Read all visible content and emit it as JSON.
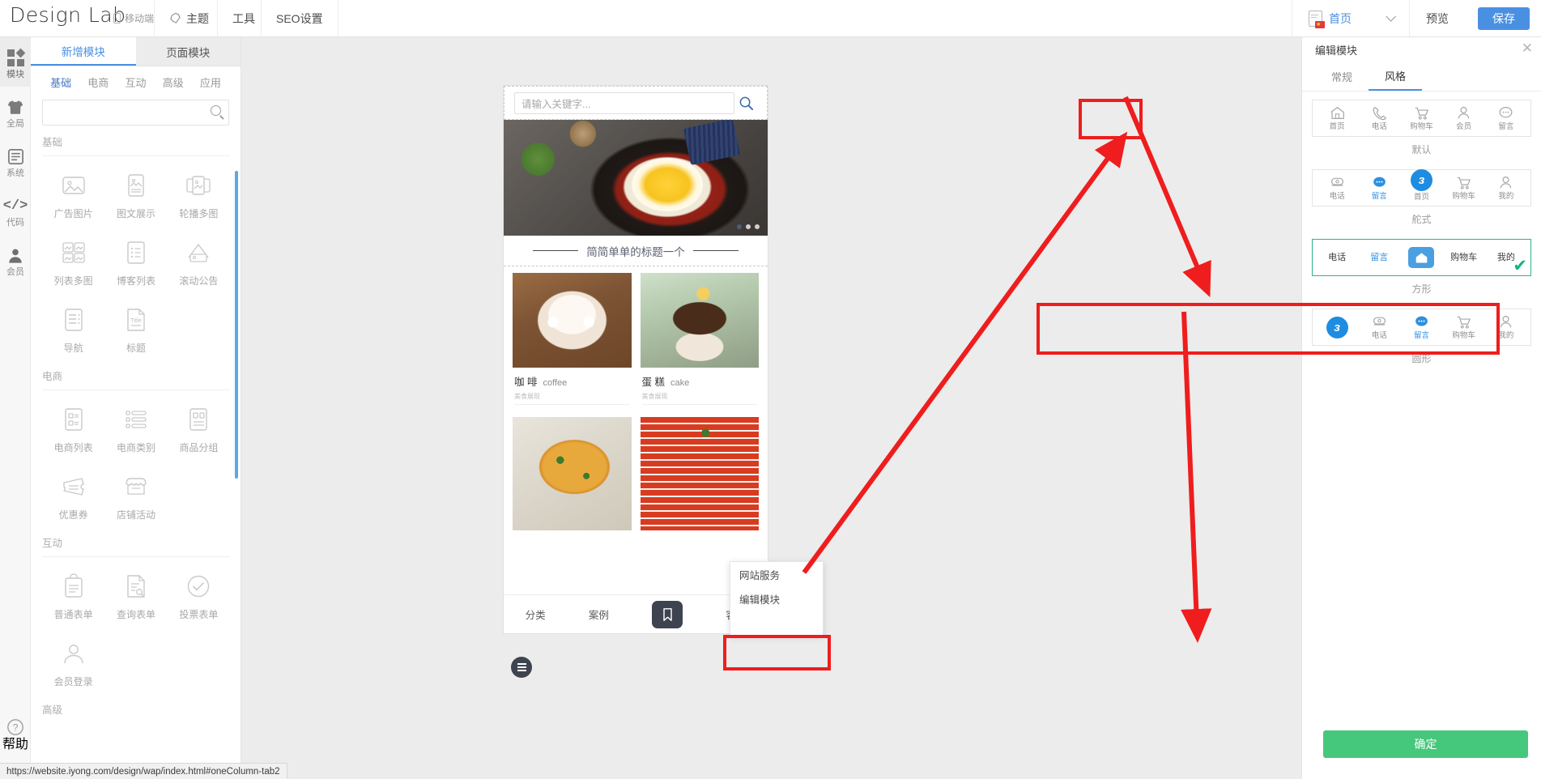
{
  "header": {
    "brand": "Design Lab",
    "device_label": "移动端",
    "menu": [
      {
        "label": "主题",
        "icon": "palette-icon"
      },
      {
        "label": "工具",
        "icon": "tools-icon"
      },
      {
        "label": "SEO设置",
        "icon": "seo-icon"
      }
    ],
    "page_selector": {
      "label": "首页",
      "icon": "page-doc-icon"
    },
    "preview_label": "预览",
    "save_label": "保存",
    "accent_blue": "#4a90e2"
  },
  "rail": {
    "items": [
      {
        "label": "模块",
        "icon": "grid-icon",
        "active": true
      },
      {
        "label": "全局",
        "icon": "shirt-icon",
        "active": false
      },
      {
        "label": "系统",
        "icon": "document-icon",
        "active": false
      },
      {
        "label": "代码",
        "icon": "code-icon",
        "active": false
      },
      {
        "label": "会员",
        "icon": "user-icon",
        "active": false
      }
    ],
    "help": {
      "label": "帮助",
      "icon": "question-circle-icon"
    }
  },
  "panel": {
    "tabs": [
      {
        "label": "新增模块",
        "active": true
      },
      {
        "label": "页面模块",
        "active": false
      }
    ],
    "categories": [
      {
        "label": "基础",
        "active": true
      },
      {
        "label": "电商",
        "active": false
      },
      {
        "label": "互动",
        "active": false
      },
      {
        "label": "高级",
        "active": false
      },
      {
        "label": "应用",
        "active": false
      }
    ],
    "search": {
      "value": "",
      "placeholder": ""
    },
    "groups": [
      {
        "title": "基础",
        "items": [
          {
            "label": "广告图片",
            "icon": "image-icon"
          },
          {
            "label": "图文展示",
            "icon": "image-text-icon"
          },
          {
            "label": "轮播多图",
            "icon": "carousel-icon"
          },
          {
            "label": "列表多图",
            "icon": "multi-image-icon"
          },
          {
            "label": "博客列表",
            "icon": "blog-list-icon"
          },
          {
            "label": "滚动公告",
            "icon": "announce-icon"
          },
          {
            "label": "导航",
            "icon": "nav-icon"
          },
          {
            "label": "标题",
            "icon": "title-icon"
          }
        ]
      },
      {
        "title": "电商",
        "items": [
          {
            "label": "电商列表",
            "icon": "shop-list-icon"
          },
          {
            "label": "电商类别",
            "icon": "shop-category-icon"
          },
          {
            "label": "商品分组",
            "icon": "product-group-icon"
          },
          {
            "label": "优惠券",
            "icon": "coupon-icon"
          },
          {
            "label": "店铺活动",
            "icon": "store-activity-icon"
          }
        ]
      },
      {
        "title": "互动",
        "items": [
          {
            "label": "普通表单",
            "icon": "form-icon"
          },
          {
            "label": "查询表单",
            "icon": "query-form-icon"
          },
          {
            "label": "投票表单",
            "icon": "vote-form-icon"
          },
          {
            "label": "会员登录",
            "icon": "member-login-icon"
          }
        ]
      },
      {
        "title": "高级",
        "items": []
      }
    ]
  },
  "preview": {
    "search": {
      "placeholder": "请输入关键字...",
      "icon": "search-icon"
    },
    "banner": {
      "icon": "food-banner-image",
      "dots": 3,
      "active_dot": 0
    },
    "section_title": "简简单单的标题一个",
    "products": [
      {
        "name_cn": "咖 啡",
        "name_en": "coffee",
        "sub": "美食展现",
        "image": "coffee-bear-latte-image"
      },
      {
        "name_cn": "蛋 糕",
        "name_en": "cake",
        "sub": "美食展现",
        "image": "chocolate-cupcake-image"
      },
      {
        "name_cn": "",
        "name_en": "",
        "sub": "",
        "image": "pizza-image"
      },
      {
        "name_cn": "",
        "name_en": "",
        "sub": "",
        "image": "sliced-tomato-image"
      }
    ],
    "fab": {
      "icon": "hamburger-menu-icon"
    },
    "tabbar": [
      {
        "label": "分类",
        "type": "text"
      },
      {
        "label": "案例",
        "type": "text"
      },
      {
        "label": "",
        "type": "bookmark-icon"
      },
      {
        "label": "客服",
        "type": "text"
      }
    ]
  },
  "context_menu": {
    "items": [
      {
        "label": "网站服务",
        "highlighted": false
      },
      {
        "label": "编辑模块",
        "highlighted": true
      }
    ]
  },
  "right_panel": {
    "title": "编辑模块",
    "close_icon": "close-icon",
    "tabs": [
      {
        "label": "常规",
        "active": false
      },
      {
        "label": "风格",
        "active": true
      }
    ],
    "styles": [
      {
        "name": "默认",
        "selected": false,
        "items": [
          {
            "label": "首页",
            "icon": "home-outline-icon",
            "style": "outline"
          },
          {
            "label": "电话",
            "icon": "phone-outline-icon",
            "style": "outline"
          },
          {
            "label": "购物车",
            "icon": "cart-outline-icon",
            "style": "outline"
          },
          {
            "label": "会员",
            "icon": "user-outline-icon",
            "style": "outline"
          },
          {
            "label": "留言",
            "icon": "chat-outline-icon",
            "style": "outline"
          }
        ]
      },
      {
        "name": "舵式",
        "selected": false,
        "items": [
          {
            "label": "电话",
            "icon": "telephone-outline-icon",
            "style": "outline"
          },
          {
            "label": "留言",
            "icon": "chat-dots-icon",
            "style": "blue-text"
          },
          {
            "label": "首页",
            "icon": "brand-badge-icon",
            "style": "badge-round"
          },
          {
            "label": "购物车",
            "icon": "cart-outline-icon",
            "style": "outline"
          },
          {
            "label": "我的",
            "icon": "user-outline-icon",
            "style": "outline"
          }
        ]
      },
      {
        "name": "方形",
        "selected": true,
        "items": [
          {
            "label": "电话",
            "icon": "",
            "style": "text-only"
          },
          {
            "label": "留言",
            "icon": "",
            "style": "blue-text-only"
          },
          {
            "label": "",
            "icon": "home-square-badge-icon",
            "style": "badge-square"
          },
          {
            "label": "购物车",
            "icon": "",
            "style": "text-only"
          },
          {
            "label": "我的",
            "icon": "",
            "style": "text-only"
          }
        ]
      },
      {
        "name": "圆形",
        "selected": false,
        "items": [
          {
            "label": "",
            "icon": "brand-badge-icon",
            "style": "badge-round"
          },
          {
            "label": "电话",
            "icon": "telephone-outline-icon",
            "style": "outline"
          },
          {
            "label": "留言",
            "icon": "chat-dots-icon",
            "style": "blue-text"
          },
          {
            "label": "购物车",
            "icon": "cart-outline-icon",
            "style": "outline"
          },
          {
            "label": "我的",
            "icon": "user-outline-icon",
            "style": "outline"
          }
        ]
      }
    ],
    "confirm_label": "确定",
    "confirm_color": "#45c87c",
    "selected_color": "#2cb389"
  },
  "annotations": {
    "color": "#ef1d1d",
    "boxes": [
      "style-tab",
      "style-card-square",
      "context-menu-edit"
    ],
    "arrows": 3
  },
  "statusbar": {
    "url": "https://website.iyong.com/design/wap/index.html#oneColumn-tab2"
  }
}
